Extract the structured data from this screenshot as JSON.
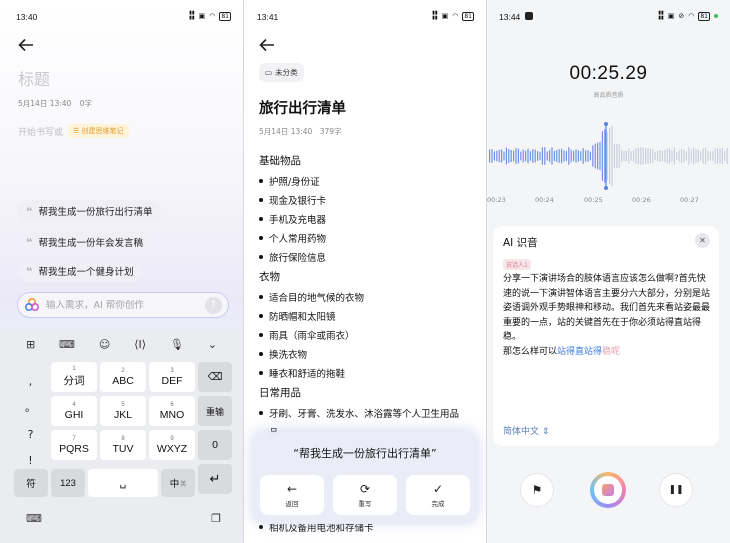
{
  "screen1": {
    "status_time": "13:40",
    "battery": "81",
    "title_placeholder": "标题",
    "meta_date": "5月14日 13:40",
    "meta_count": "0字",
    "start_text": "开始书写或",
    "mindmap_chip": "☰ 创建思维笔记",
    "suggestions": [
      "帮我生成一份旅行出行清单",
      "帮我生成一份年会发言稿",
      "帮我生成一个健身计划"
    ],
    "ai_input_placeholder": "输入需求，AI 帮你创作",
    "keyboard": {
      "left_col": [
        ",",
        "。",
        "?",
        "!"
      ],
      "rows": [
        [
          {
            "label": "分词",
            "num": "1"
          },
          {
            "label": "ABC",
            "num": "2"
          },
          {
            "label": "DEF",
            "num": "3"
          }
        ],
        [
          {
            "label": "GHI",
            "num": "4"
          },
          {
            "label": "JKL",
            "num": "5"
          },
          {
            "label": "MNO",
            "num": "6"
          }
        ],
        [
          {
            "label": "PQRS",
            "num": "7"
          },
          {
            "label": "TUV",
            "num": "8"
          },
          {
            "label": "WXYZ",
            "num": "9"
          }
        ]
      ],
      "right_col": [
        "⌫",
        "重输",
        "0",
        "↵"
      ],
      "bottom": {
        "symbol": "符",
        "num": "123",
        "space": "␣",
        "lang": "中",
        "lang_sub": "英"
      }
    }
  },
  "screen2": {
    "status_time": "13:41",
    "battery": "81",
    "folder_chip": "未分类",
    "title": "旅行出行清单",
    "meta_date": "5月14日 13:40",
    "meta_count": "379字",
    "sections": [
      {
        "name": "基础物品",
        "items": [
          "护照/身份证",
          "现金及银行卡",
          "手机及充电器",
          "个人常用药物",
          "旅行保险信息"
        ]
      },
      {
        "name": "衣物",
        "items": [
          "适合目的地气候的衣物",
          "防晒帽和太阳镜",
          "雨具（雨伞或雨衣）",
          "换洗衣物",
          "睡衣和舒适的拖鞋"
        ]
      },
      {
        "name": "日常用品",
        "items": [
          "牙刷、牙膏、洗发水、沐浴露等个人卫生用品"
        ]
      }
    ],
    "hidden_tail": "品",
    "bottom_item": "相机及备用电池和存储卡",
    "prompt": "“帮我生成一份旅行出行清单”",
    "buttons": [
      {
        "icon": "←",
        "label": "返回"
      },
      {
        "icon": "⟳",
        "label": "重写"
      },
      {
        "icon": "✓",
        "label": "完成"
      }
    ]
  },
  "screen3": {
    "status_time": "13:44",
    "battery": "81",
    "timer": "00:25.29",
    "quality": "高品质音质",
    "ticks": [
      "00:23",
      "00:24",
      "00:25",
      "00:26",
      "00:27"
    ],
    "card_title": "AI 识音",
    "speaker": "说话人1",
    "transcript_main": "分享一下演讲场合的肢体语言应该怎么做啊?首先快速的说一下演讲智体语言主要分六大部分，分别是站姿语调外观手势眼神和移动。我们首先来看站姿最最重要的一点，站的关键首先在于你必须站得直站得稳。",
    "transcript_tail_prefix": "那怎么样可以",
    "transcript_tail_blue": "站得直站得",
    "transcript_tail_pink": "稳呢",
    "language": "简体中文 ⇕",
    "controls": {
      "flag": "⚑",
      "pause": "❚❚"
    }
  }
}
